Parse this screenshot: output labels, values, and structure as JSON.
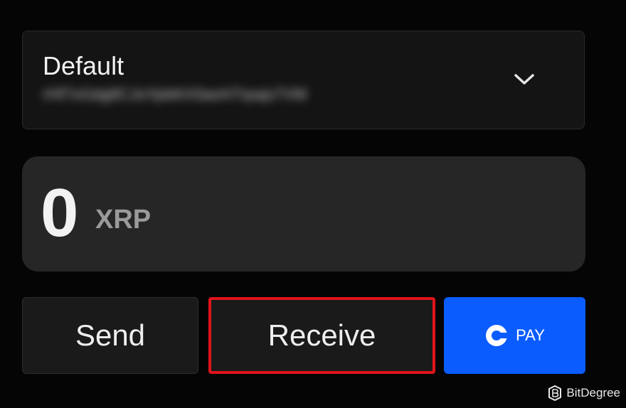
{
  "account": {
    "name": "Default",
    "address": "rHf7xGdg8CJoYpbKH3aoH7rpajs7VM",
    "address_blurred": true,
    "dropdown_icon": "chevron-down-icon"
  },
  "balance": {
    "amount": "0",
    "currency": "XRP"
  },
  "actions": {
    "send_label": "Send",
    "receive_label": "Receive",
    "pay_label": "PAY",
    "pay_icon": "coinbase-pay-icon",
    "highlight_color": "#e0141b",
    "pay_color": "#0a5cff"
  },
  "watermark": {
    "text": "BitDegree",
    "icon": "bitdegree-logo-icon"
  }
}
